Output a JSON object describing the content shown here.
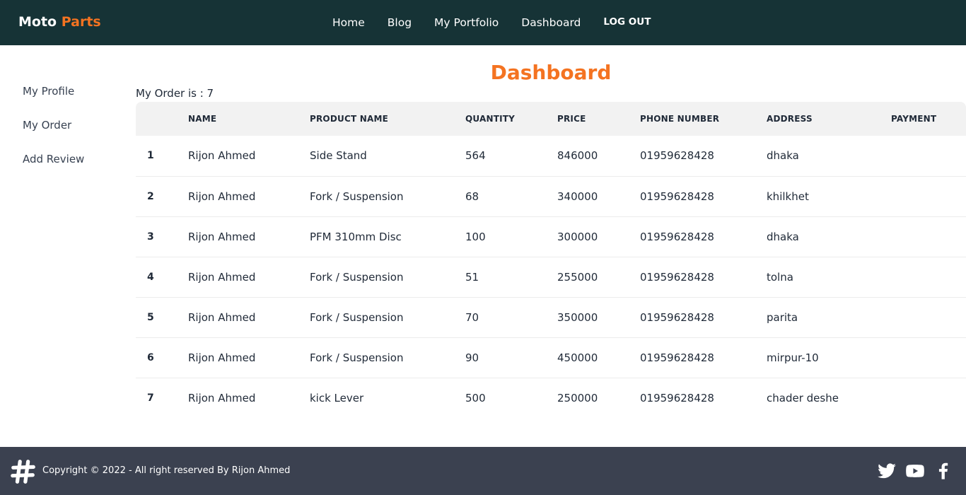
{
  "navbar": {
    "brand_first": "Moto",
    "brand_second": "Parts",
    "links": [
      "Home",
      "Blog",
      "My Portfolio",
      "Dashboard"
    ],
    "logout": "LOG OUT"
  },
  "sidebar": {
    "items": [
      "My Profile",
      "My Order",
      "Add Review"
    ]
  },
  "main": {
    "title": "Dashboard",
    "order_count_text": "My Order is : 7"
  },
  "table": {
    "headers": [
      "",
      "NAME",
      "PRODUCT NAME",
      "QUANTITY",
      "PRICE",
      "PHONE NUMBER",
      "ADDRESS",
      "PAYMENT"
    ],
    "rows": [
      {
        "index": "1",
        "name": "Rijon Ahmed",
        "product": "Side Stand",
        "quantity": "564",
        "price": "846000",
        "phone": "01959628428",
        "address": "dhaka",
        "payment": ""
      },
      {
        "index": "2",
        "name": "Rijon Ahmed",
        "product": "Fork / Suspension",
        "quantity": "68",
        "price": "340000",
        "phone": "01959628428",
        "address": "khilkhet",
        "payment": ""
      },
      {
        "index": "3",
        "name": "Rijon Ahmed",
        "product": "PFM 310mm Disc",
        "quantity": "100",
        "price": "300000",
        "phone": "01959628428",
        "address": "dhaka",
        "payment": ""
      },
      {
        "index": "4",
        "name": "Rijon Ahmed",
        "product": "Fork / Suspension",
        "quantity": "51",
        "price": "255000",
        "phone": "01959628428",
        "address": "tolna",
        "payment": ""
      },
      {
        "index": "5",
        "name": "Rijon Ahmed",
        "product": "Fork / Suspension",
        "quantity": "70",
        "price": "350000",
        "phone": "01959628428",
        "address": "parita",
        "payment": ""
      },
      {
        "index": "6",
        "name": "Rijon Ahmed",
        "product": "Fork / Suspension",
        "quantity": "90",
        "price": "450000",
        "phone": "01959628428",
        "address": "mirpur-10",
        "payment": ""
      },
      {
        "index": "7",
        "name": "Rijon Ahmed",
        "product": "kick Lever",
        "quantity": "500",
        "price": "250000",
        "phone": "01959628428",
        "address": "chader deshe",
        "payment": ""
      }
    ]
  },
  "footer": {
    "copyright": "Copyright © 2022 - All right reserved By Rijon Ahmed",
    "logo_icon": "hashtag-logo-icon",
    "social_icons": [
      "twitter-icon",
      "youtube-icon",
      "facebook-icon"
    ]
  },
  "colors": {
    "navbar_bg": "#163336",
    "accent": "#f47321",
    "footer_bg": "#3b4150",
    "table_header_bg": "#f2f2f2"
  }
}
